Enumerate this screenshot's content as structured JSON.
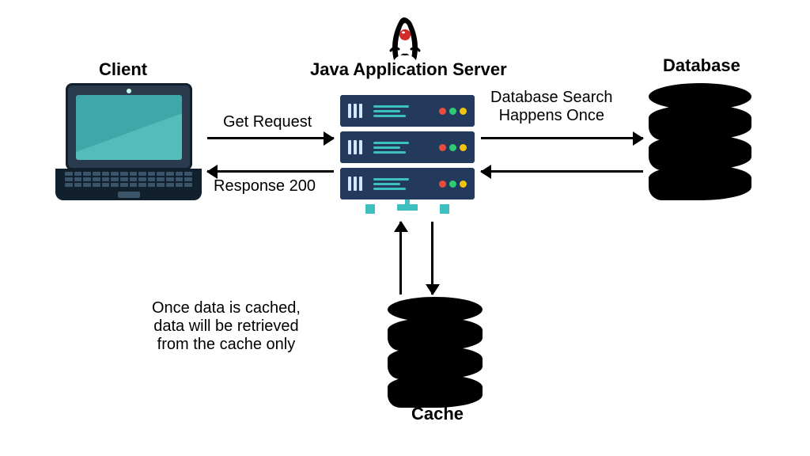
{
  "labels": {
    "client": "Client",
    "server": "Java Application Server",
    "database": "Database",
    "cache": "Cache"
  },
  "arrows": {
    "request": "Get Request",
    "response": "Response 200",
    "db_search": "Database Search\nHappens Once"
  },
  "notes": {
    "cache_note": "Once data is cached,\ndata will be retrieved\nfrom the cache only"
  }
}
